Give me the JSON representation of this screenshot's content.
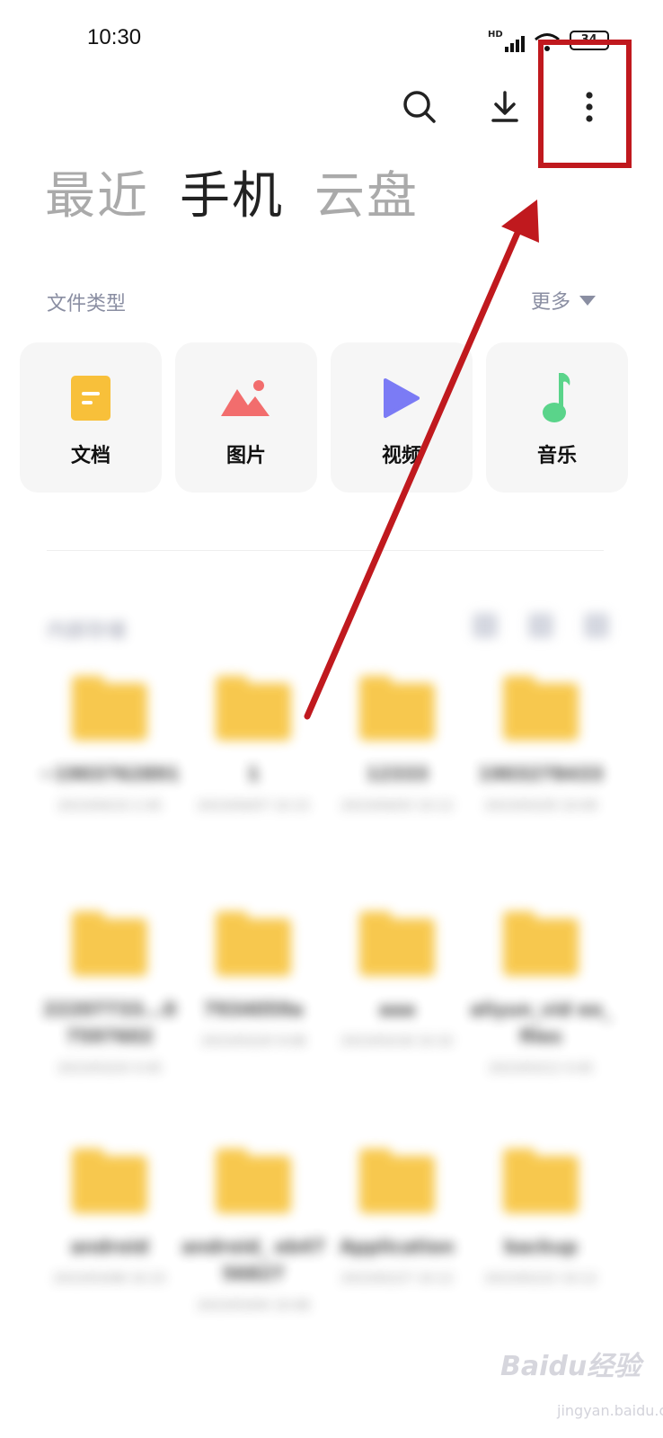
{
  "status_bar": {
    "time": "10:30",
    "network": "HD",
    "battery": "34"
  },
  "toolbar": {
    "search_icon": "search-icon",
    "download_icon": "download-icon",
    "more_icon": "more-vertical-icon"
  },
  "tabs": [
    {
      "label": "最近",
      "active": false
    },
    {
      "label": "手机",
      "active": true
    },
    {
      "label": "云盘",
      "active": false
    }
  ],
  "file_types": {
    "title": "文件类型",
    "more_label": "更多",
    "items": [
      {
        "label": "文档",
        "icon": "document-icon",
        "color": "#f8c03a"
      },
      {
        "label": "图片",
        "icon": "image-icon",
        "color": "#f26d6d"
      },
      {
        "label": "视频",
        "icon": "video-icon",
        "color": "#7b7bf5"
      },
      {
        "label": "音乐",
        "icon": "music-icon",
        "color": "#5ad48a"
      }
    ]
  },
  "storage": {
    "title": "内部存储",
    "folders": [
      {
        "name": "~1903762891",
        "date": "2023/04/10 2:45"
      },
      {
        "name": "1",
        "date": "2023/04/07 10:15"
      },
      {
        "name": "12333",
        "date": "2023/04/03 10:12"
      },
      {
        "name": "1903278433",
        "date": "2023/03/29 10:09"
      },
      {
        "name": "22207733...07597602",
        "date": "2023/03/24 4:45"
      },
      {
        "name": "7934059a",
        "date": "2023/03/20 9:08"
      },
      {
        "name": "aaa",
        "date": "2023/03/18 10:32"
      },
      {
        "name": "aliyun_vid eo_files",
        "date": "2023/03/12 4:45"
      },
      {
        "name": "android",
        "date": "2023/03/08 10:15"
      },
      {
        "name": "android_ eb4756827",
        "date": "2023/03/04 10:08"
      },
      {
        "name": "Application",
        "date": "2023/02/27 10:12"
      },
      {
        "name": "backup",
        "date": "2023/02/22 10:12"
      }
    ]
  },
  "watermark": {
    "text": "Baidu经验",
    "sub": "jingyan.baidu.com"
  },
  "colors": {
    "annotation": "#c0191e",
    "folder": "#f7c33b",
    "muted_text": "#8a8ea2"
  }
}
